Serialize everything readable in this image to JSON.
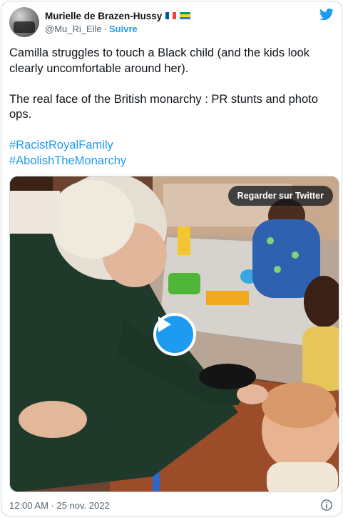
{
  "tweet": {
    "author": {
      "display_name": "Murielle de Brazen-Hussy",
      "handle": "@Mu_Ri_Elle",
      "separator": "·",
      "follow_label": "Suivre",
      "flags": [
        "france-flag-icon",
        "gabon-flag-icon"
      ]
    },
    "text": {
      "line1": "Camilla struggles to touch a Black child (and the kids look clearly uncomfortable around her).",
      "line2": "The real face of the British monarchy : PR stunts and photo ops.",
      "hashtags": [
        "#RacistRoyalFamily",
        "#AbolishTheMonarchy"
      ]
    },
    "media": {
      "watch_label": "Regarder sur Twitter",
      "type": "video"
    },
    "footer": {
      "timestamp": "12:00 AM · 25 nov. 2022"
    }
  },
  "colors": {
    "accent": "#1d9bf0",
    "text": "#0f1419",
    "muted": "#536471",
    "border": "#cfd9de"
  }
}
